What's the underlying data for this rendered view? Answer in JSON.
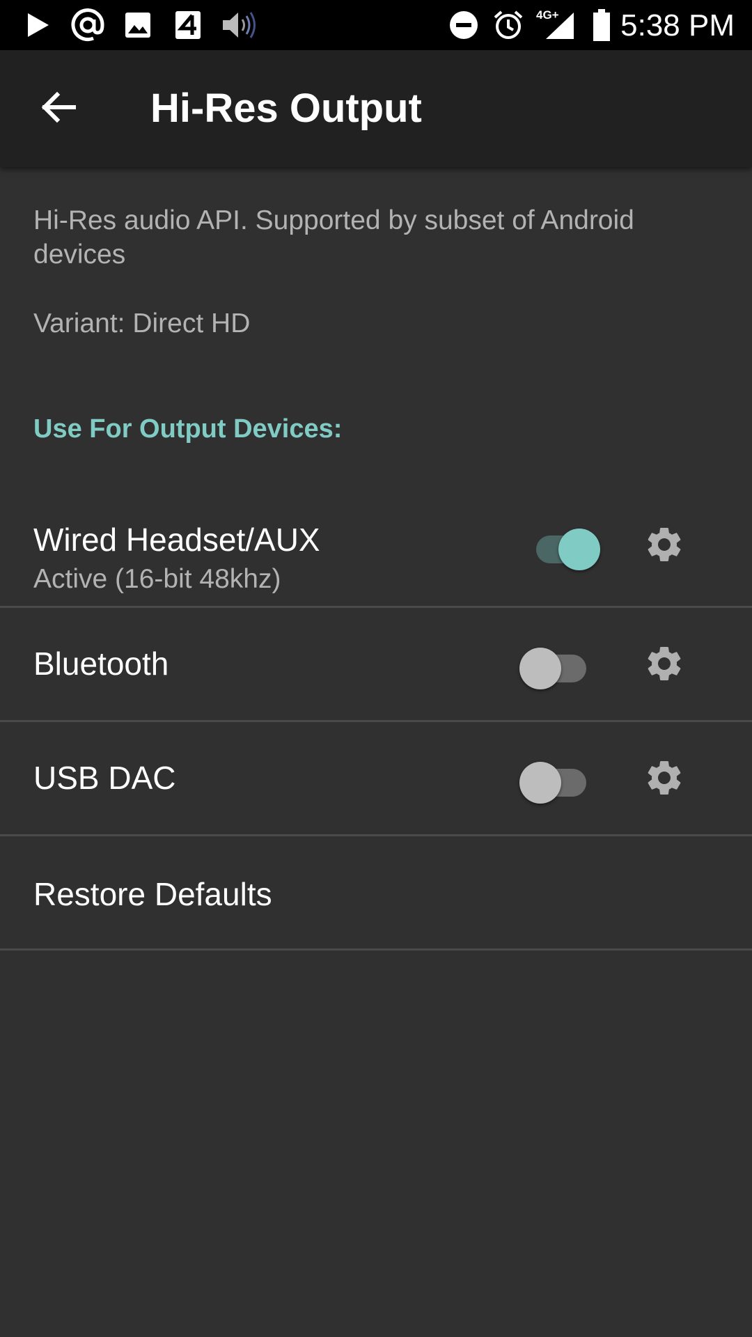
{
  "status_bar": {
    "time": "5:38 PM",
    "network_label": "4G+",
    "left_icons": [
      "play-store-icon",
      "at-sign-icon",
      "gallery-icon",
      "app-4-icon",
      "speaker-volume-icon"
    ],
    "right_icons": [
      "do-not-disturb-icon",
      "alarm-icon",
      "signal-icon",
      "battery-icon"
    ]
  },
  "app_bar": {
    "back_icon": "arrow-back-icon",
    "title": "Hi-Res Output"
  },
  "description": "Hi-Res audio API. Supported by subset of Android devices",
  "variant": "Variant: Direct HD",
  "section_header": "Use For Output Devices:",
  "devices": [
    {
      "title": "Wired Headset/AUX",
      "subtitle": "Active (16-bit 48khz)",
      "enabled": true
    },
    {
      "title": "Bluetooth",
      "subtitle": "",
      "enabled": false
    },
    {
      "title": "USB DAC",
      "subtitle": "",
      "enabled": false
    }
  ],
  "restore_defaults": "Restore Defaults",
  "colors": {
    "accent": "#80cbc4",
    "background": "#303030",
    "app_bar": "#212121",
    "status_bar": "#000000"
  }
}
